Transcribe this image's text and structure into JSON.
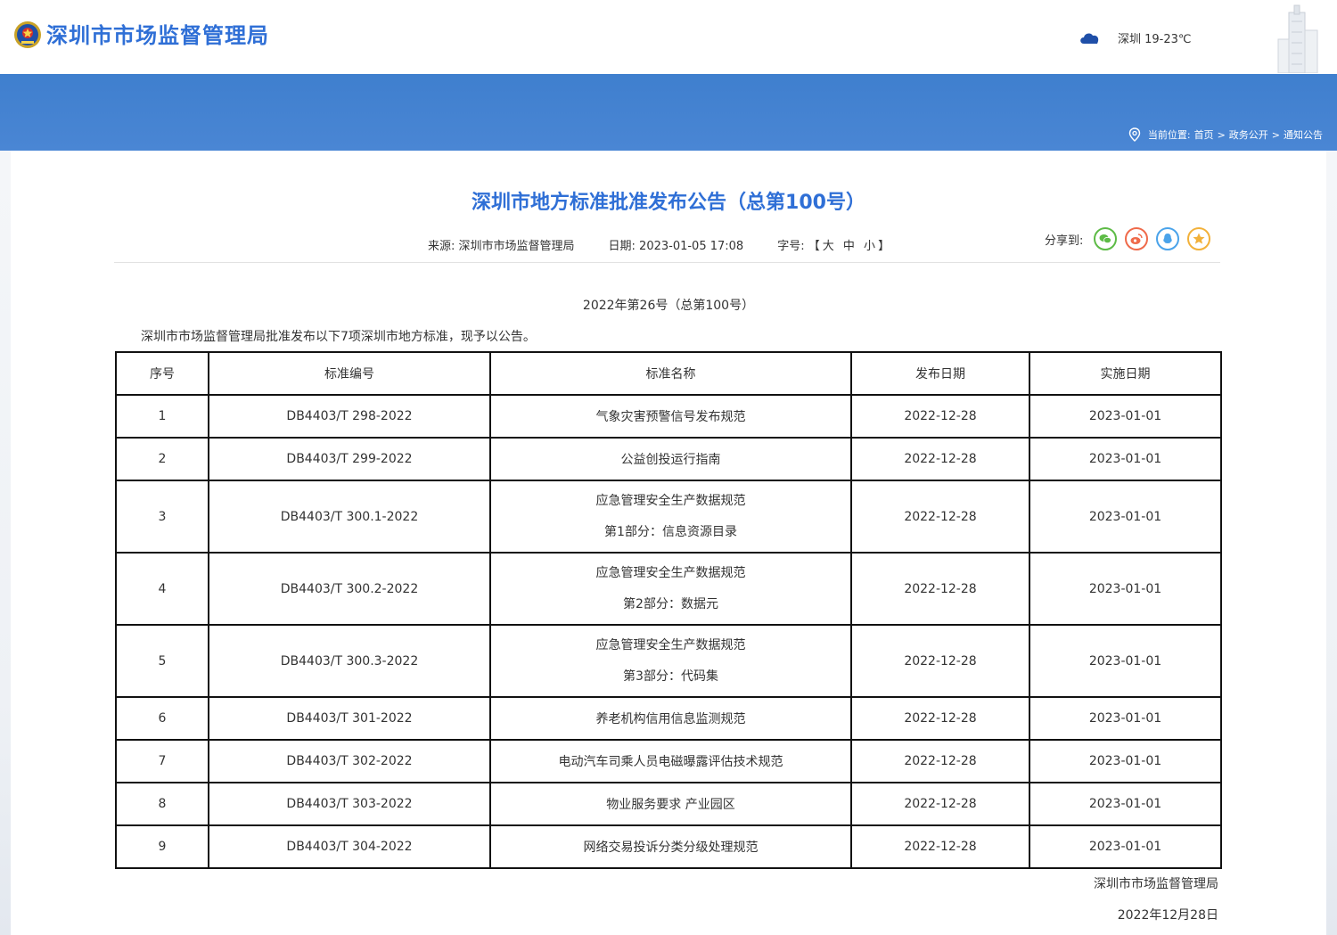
{
  "header": {
    "site_name": "深圳市市场监督管理局",
    "weather_text": "深圳 19-23℃"
  },
  "breadcrumb": {
    "label": "当前位置:",
    "items": [
      "首页",
      "政务公开",
      "通知公告"
    ],
    "separator": ">"
  },
  "article": {
    "title": "深圳市地方标准批准发布公告（总第100号）",
    "source_label": "来源: ",
    "source": "深圳市市场监督管理局",
    "date_label": "日期: ",
    "date": "2023-01-05 17:08",
    "font_label": "字号: ",
    "font_open": "【",
    "font_large": "大",
    "font_medium": "中",
    "font_small": "小",
    "font_close": "】",
    "share_label": "分享到:",
    "subtitle": "2022年第26号（总第100号）",
    "intro": "深圳市市场监督管理局批准发布以下7项深圳市地方标准，现予以公告。",
    "footer_org": "深圳市市场监督管理局",
    "footer_date": "2022年12月28日"
  },
  "share_buttons": [
    {
      "name": "wechat",
      "color": "#5dbb46"
    },
    {
      "name": "weibo",
      "color": "#ef6a4a"
    },
    {
      "name": "qq",
      "color": "#4aa3ea"
    },
    {
      "name": "favorite",
      "color": "#f2b13a"
    }
  ],
  "table": {
    "headers": [
      "序号",
      "标准编号",
      "标准名称",
      "发布日期",
      "实施日期"
    ],
    "rows": [
      {
        "no": "1",
        "code": "DB4403/T 298-2022",
        "name1": "气象灾害预警信号发布规范",
        "name2": "",
        "publish": "2022-12-28",
        "effective": "2023-01-01"
      },
      {
        "no": "2",
        "code": "DB4403/T 299-2022",
        "name1": "公益创投运行指南",
        "name2": "",
        "publish": "2022-12-28",
        "effective": "2023-01-01"
      },
      {
        "no": "3",
        "code": "DB4403/T 300.1-2022",
        "name1": "应急管理安全生产数据规范",
        "name2": "第1部分：信息资源目录",
        "publish": "2022-12-28",
        "effective": "2023-01-01"
      },
      {
        "no": "4",
        "code": "DB4403/T 300.2-2022",
        "name1": "应急管理安全生产数据规范",
        "name2": "第2部分：数据元",
        "publish": "2022-12-28",
        "effective": "2023-01-01"
      },
      {
        "no": "5",
        "code": "DB4403/T 300.3-2022",
        "name1": "应急管理安全生产数据规范",
        "name2": "第3部分：代码集",
        "publish": "2022-12-28",
        "effective": "2023-01-01"
      },
      {
        "no": "6",
        "code": "DB4403/T 301-2022",
        "name1": "养老机构信用信息监测规范",
        "name2": "",
        "publish": "2022-12-28",
        "effective": "2023-01-01"
      },
      {
        "no": "7",
        "code": "DB4403/T 302-2022",
        "name1": "电动汽车司乘人员电磁曝露评估技术规范",
        "name2": "",
        "publish": "2022-12-28",
        "effective": "2023-01-01"
      },
      {
        "no": "8",
        "code": "DB4403/T 303-2022",
        "name1": "物业服务要求 产业园区",
        "name2": "",
        "publish": "2022-12-28",
        "effective": "2023-01-01"
      },
      {
        "no": "9",
        "code": "DB4403/T 304-2022",
        "name1": "网络交易投诉分类分级处理规范",
        "name2": "",
        "publish": "2022-12-28",
        "effective": "2023-01-01"
      }
    ]
  }
}
